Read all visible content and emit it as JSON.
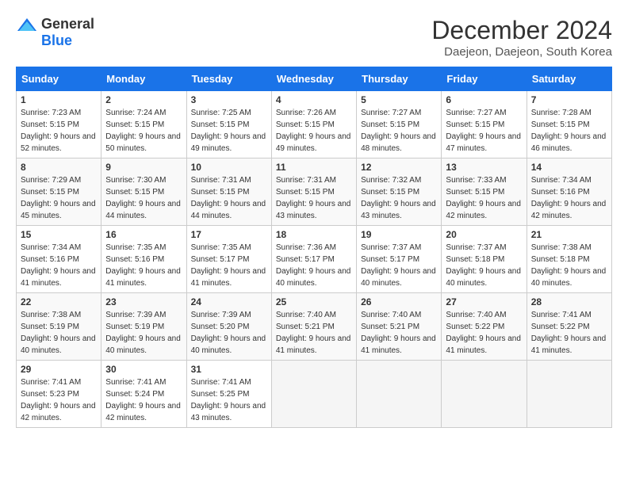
{
  "logo": {
    "general": "General",
    "blue": "Blue"
  },
  "title": {
    "month": "December 2024",
    "location": "Daejeon, Daejeon, South Korea"
  },
  "weekdays": [
    "Sunday",
    "Monday",
    "Tuesday",
    "Wednesday",
    "Thursday",
    "Friday",
    "Saturday"
  ],
  "weeks": [
    [
      {
        "day": "1",
        "sunrise": "7:23 AM",
        "sunset": "5:15 PM",
        "daylight": "9 hours and 52 minutes."
      },
      {
        "day": "2",
        "sunrise": "7:24 AM",
        "sunset": "5:15 PM",
        "daylight": "9 hours and 50 minutes."
      },
      {
        "day": "3",
        "sunrise": "7:25 AM",
        "sunset": "5:15 PM",
        "daylight": "9 hours and 49 minutes."
      },
      {
        "day": "4",
        "sunrise": "7:26 AM",
        "sunset": "5:15 PM",
        "daylight": "9 hours and 49 minutes."
      },
      {
        "day": "5",
        "sunrise": "7:27 AM",
        "sunset": "5:15 PM",
        "daylight": "9 hours and 48 minutes."
      },
      {
        "day": "6",
        "sunrise": "7:27 AM",
        "sunset": "5:15 PM",
        "daylight": "9 hours and 47 minutes."
      },
      {
        "day": "7",
        "sunrise": "7:28 AM",
        "sunset": "5:15 PM",
        "daylight": "9 hours and 46 minutes."
      }
    ],
    [
      {
        "day": "8",
        "sunrise": "7:29 AM",
        "sunset": "5:15 PM",
        "daylight": "9 hours and 45 minutes."
      },
      {
        "day": "9",
        "sunrise": "7:30 AM",
        "sunset": "5:15 PM",
        "daylight": "9 hours and 44 minutes."
      },
      {
        "day": "10",
        "sunrise": "7:31 AM",
        "sunset": "5:15 PM",
        "daylight": "9 hours and 44 minutes."
      },
      {
        "day": "11",
        "sunrise": "7:31 AM",
        "sunset": "5:15 PM",
        "daylight": "9 hours and 43 minutes."
      },
      {
        "day": "12",
        "sunrise": "7:32 AM",
        "sunset": "5:15 PM",
        "daylight": "9 hours and 43 minutes."
      },
      {
        "day": "13",
        "sunrise": "7:33 AM",
        "sunset": "5:15 PM",
        "daylight": "9 hours and 42 minutes."
      },
      {
        "day": "14",
        "sunrise": "7:34 AM",
        "sunset": "5:16 PM",
        "daylight": "9 hours and 42 minutes."
      }
    ],
    [
      {
        "day": "15",
        "sunrise": "7:34 AM",
        "sunset": "5:16 PM",
        "daylight": "9 hours and 41 minutes."
      },
      {
        "day": "16",
        "sunrise": "7:35 AM",
        "sunset": "5:16 PM",
        "daylight": "9 hours and 41 minutes."
      },
      {
        "day": "17",
        "sunrise": "7:35 AM",
        "sunset": "5:17 PM",
        "daylight": "9 hours and 41 minutes."
      },
      {
        "day": "18",
        "sunrise": "7:36 AM",
        "sunset": "5:17 PM",
        "daylight": "9 hours and 40 minutes."
      },
      {
        "day": "19",
        "sunrise": "7:37 AM",
        "sunset": "5:17 PM",
        "daylight": "9 hours and 40 minutes."
      },
      {
        "day": "20",
        "sunrise": "7:37 AM",
        "sunset": "5:18 PM",
        "daylight": "9 hours and 40 minutes."
      },
      {
        "day": "21",
        "sunrise": "7:38 AM",
        "sunset": "5:18 PM",
        "daylight": "9 hours and 40 minutes."
      }
    ],
    [
      {
        "day": "22",
        "sunrise": "7:38 AM",
        "sunset": "5:19 PM",
        "daylight": "9 hours and 40 minutes."
      },
      {
        "day": "23",
        "sunrise": "7:39 AM",
        "sunset": "5:19 PM",
        "daylight": "9 hours and 40 minutes."
      },
      {
        "day": "24",
        "sunrise": "7:39 AM",
        "sunset": "5:20 PM",
        "daylight": "9 hours and 40 minutes."
      },
      {
        "day": "25",
        "sunrise": "7:40 AM",
        "sunset": "5:21 PM",
        "daylight": "9 hours and 41 minutes."
      },
      {
        "day": "26",
        "sunrise": "7:40 AM",
        "sunset": "5:21 PM",
        "daylight": "9 hours and 41 minutes."
      },
      {
        "day": "27",
        "sunrise": "7:40 AM",
        "sunset": "5:22 PM",
        "daylight": "9 hours and 41 minutes."
      },
      {
        "day": "28",
        "sunrise": "7:41 AM",
        "sunset": "5:22 PM",
        "daylight": "9 hours and 41 minutes."
      }
    ],
    [
      {
        "day": "29",
        "sunrise": "7:41 AM",
        "sunset": "5:23 PM",
        "daylight": "9 hours and 42 minutes."
      },
      {
        "day": "30",
        "sunrise": "7:41 AM",
        "sunset": "5:24 PM",
        "daylight": "9 hours and 42 minutes."
      },
      {
        "day": "31",
        "sunrise": "7:41 AM",
        "sunset": "5:25 PM",
        "daylight": "9 hours and 43 minutes."
      },
      null,
      null,
      null,
      null
    ]
  ]
}
